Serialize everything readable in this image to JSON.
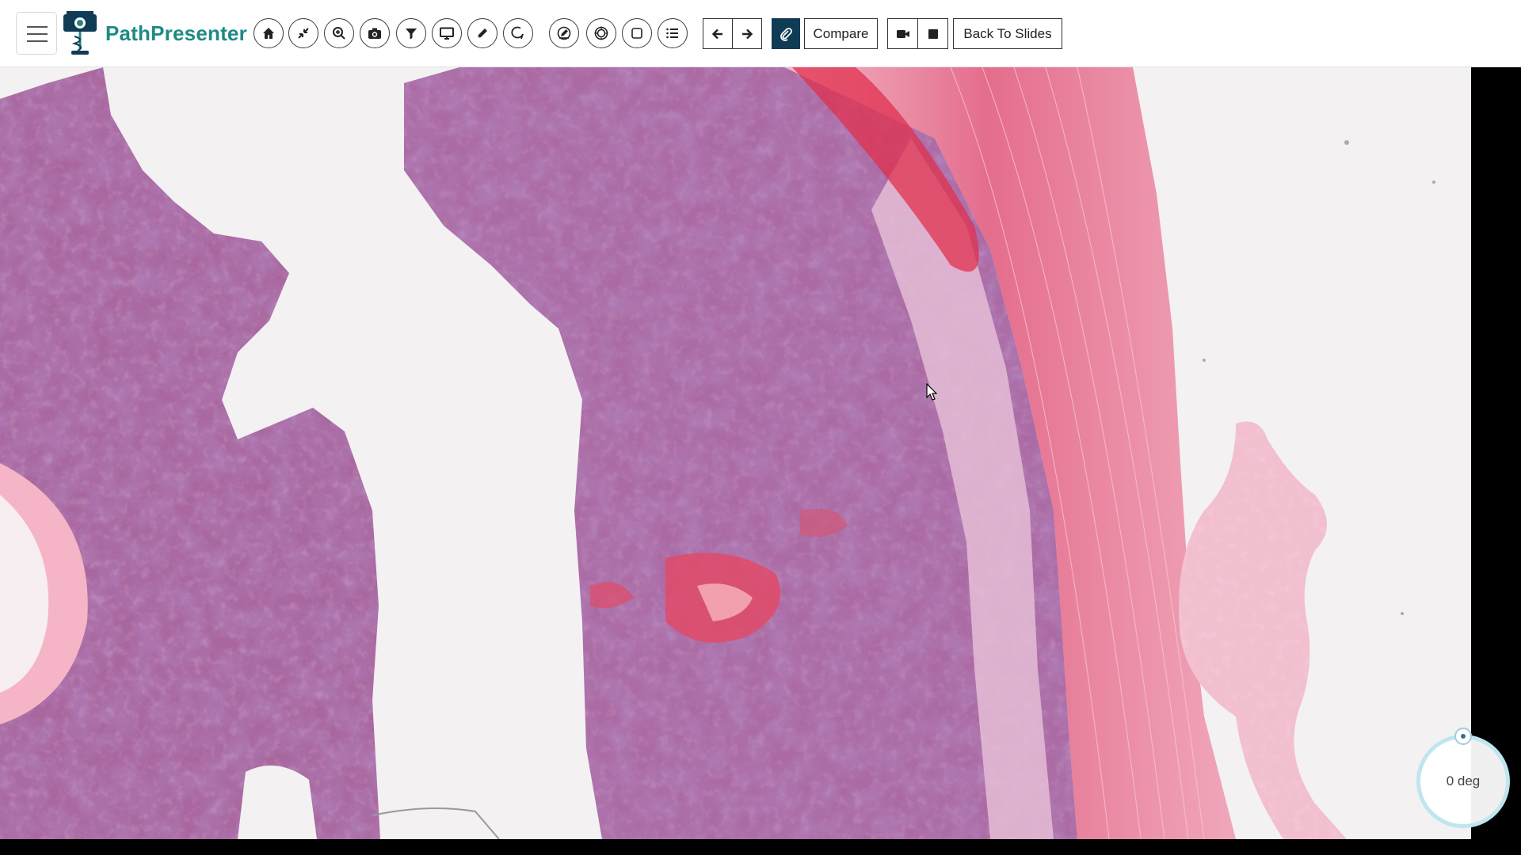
{
  "app": {
    "brand": "PathPresenter",
    "colors": {
      "brand": "#1e8a86",
      "active_button": "#0f3b55",
      "dial_ring": "#bfe6ef"
    }
  },
  "toolbar": {
    "menu_icon": "hamburger-icon",
    "icon_buttons": [
      "home-icon",
      "collapse-arrows-icon",
      "zoom-in-icon",
      "camera-icon",
      "filter-icon",
      "monitor-icon",
      "pencil-icon",
      "lasso-icon",
      "annotate-icon",
      "circle-target-icon",
      "square-icon",
      "list-icon"
    ],
    "nav": [
      "arrow-left-icon",
      "arrow-right-icon"
    ],
    "link_icon": "paperclip-icon",
    "compare_label": "Compare",
    "record_icons": [
      "video-camera-icon",
      "stop-icon"
    ],
    "back_label": "Back To Slides"
  },
  "viewer": {
    "rotation_label": "0 deg"
  }
}
